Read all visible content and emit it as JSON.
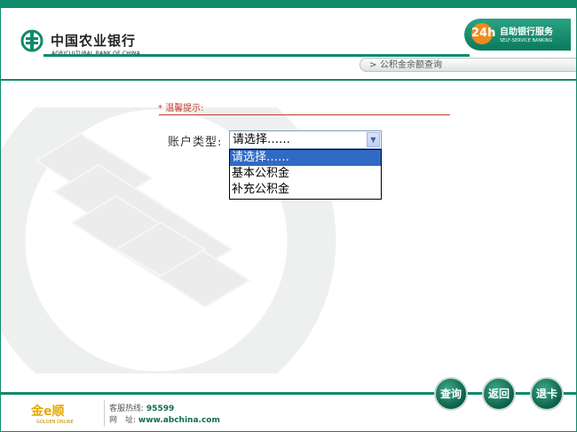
{
  "header": {
    "bank_name_cn": "中国农业银行",
    "bank_name_en": "AGRICULTURAL BANK OF CHINA",
    "badge_number": "24h",
    "badge_title": "自助银行服务",
    "badge_subtitle": "SELF-SERVICE BANKING",
    "breadcrumb": "公积金余额查询"
  },
  "content": {
    "tip_label": "温馨提示:",
    "account_type_label": "账户类型:",
    "select_value": "请选择……",
    "options": [
      {
        "label": "请选择……",
        "selected": true
      },
      {
        "label": "基本公积金",
        "selected": false
      },
      {
        "label": "补充公积金",
        "selected": false
      }
    ]
  },
  "footer": {
    "brand": "金e顺",
    "brand_sub": "GOLDEN ONLINE",
    "hotline_label": "客服热线:",
    "hotline_value": "95599",
    "website_label": "网　址:",
    "website_value": "www.abchina.com",
    "buttons": {
      "query": "查询",
      "back": "返回",
      "exit": "退卡"
    }
  },
  "colors": {
    "brand_green": "#0f8a6b",
    "accent_red": "#c0392b",
    "selection_blue": "#316ac5",
    "badge_orange": "#f08a1c"
  }
}
